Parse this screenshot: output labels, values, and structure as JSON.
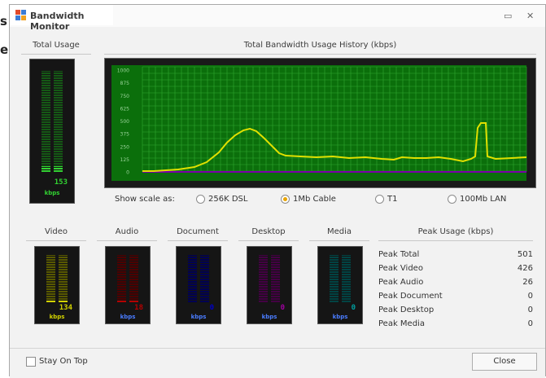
{
  "background_fragments": [
    "s",
    "e"
  ],
  "window": {
    "title": "Bandwidth Monitor",
    "minimize_glyph": "▭",
    "close_glyph": "✕"
  },
  "colors": {
    "total": "#32d232",
    "video": "#d2d200",
    "audio": "#b40000",
    "document": "#0000c8",
    "desktop": "#a000a0",
    "media": "#00a0a0",
    "graph_line": "#e0e000",
    "graph_grid": "#2fa82f",
    "graph_bg": "#0b6f0b"
  },
  "total_usage": {
    "label": "Total Usage",
    "value": "153",
    "unit": "kbps",
    "level": 0.06
  },
  "history": {
    "label": "Total Bandwidth Usage History (kbps)",
    "y_ticks": [
      "1000",
      "875",
      "750",
      "625",
      "500",
      "375",
      "250",
      "125",
      "0"
    ]
  },
  "scale": {
    "label": "Show scale as:",
    "options": [
      {
        "label": "256K DSL",
        "selected": false
      },
      {
        "label": "1Mb Cable",
        "selected": true
      },
      {
        "label": "T1",
        "selected": false
      },
      {
        "label": "100Mb LAN",
        "selected": false
      }
    ]
  },
  "meters": [
    {
      "label": "Video",
      "value": "134",
      "unit": "kbps",
      "level": 0.06,
      "color_key": "video",
      "name": "video"
    },
    {
      "label": "Audio",
      "value": "18",
      "unit": "kbps",
      "level": 0.03,
      "color_key": "audio",
      "name": "audio"
    },
    {
      "label": "Document",
      "value": "0",
      "unit": "kbps",
      "level": 0.0,
      "color_key": "document",
      "name": "document"
    },
    {
      "label": "Desktop",
      "value": "0",
      "unit": "kbps",
      "level": 0.0,
      "color_key": "desktop",
      "name": "desktop"
    },
    {
      "label": "Media",
      "value": "0",
      "unit": "kbps",
      "level": 0.0,
      "color_key": "media",
      "name": "media"
    }
  ],
  "peak": {
    "label": "Peak Usage (kbps)",
    "rows": [
      {
        "name": "Peak Total",
        "value": "501"
      },
      {
        "name": "Peak Video",
        "value": "426"
      },
      {
        "name": "Peak Audio",
        "value": "26"
      },
      {
        "name": "Peak Document",
        "value": "0"
      },
      {
        "name": "Peak Desktop",
        "value": "0"
      },
      {
        "name": "Peak Media",
        "value": "0"
      }
    ]
  },
  "footer": {
    "stay_on_top": "Stay On Top",
    "stay_on_top_checked": false,
    "close": "Close"
  }
}
